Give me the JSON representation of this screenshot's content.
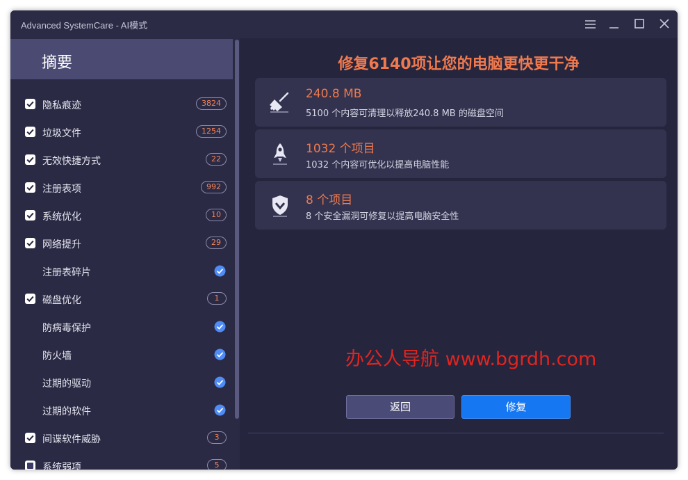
{
  "window": {
    "title": "Advanced SystemCare - AI模式"
  },
  "sidebar": {
    "title": "摘要",
    "items": [
      {
        "label": "隐私痕迹",
        "checkbox": "checked",
        "badge": "3824"
      },
      {
        "label": "垃圾文件",
        "checkbox": "checked",
        "badge": "1254"
      },
      {
        "label": "无效快捷方式",
        "checkbox": "checked",
        "badge": "22"
      },
      {
        "label": "注册表项",
        "checkbox": "checked",
        "badge": "992"
      },
      {
        "label": "系统优化",
        "checkbox": "checked",
        "badge": "10"
      },
      {
        "label": "网络提升",
        "checkbox": "checked",
        "badge": "29"
      },
      {
        "label": "注册表碎片",
        "checkbox": "none",
        "status": "ok"
      },
      {
        "label": "磁盘优化",
        "checkbox": "checked",
        "badge": "1"
      },
      {
        "label": "防病毒保护",
        "checkbox": "none",
        "status": "ok"
      },
      {
        "label": "防火墙",
        "checkbox": "none",
        "status": "ok"
      },
      {
        "label": "过期的驱动",
        "checkbox": "none",
        "status": "ok"
      },
      {
        "label": "过期的软件",
        "checkbox": "none",
        "status": "ok"
      },
      {
        "label": "间谍软件威胁",
        "checkbox": "checked",
        "badge": "3"
      },
      {
        "label": "系统弱项",
        "checkbox": "partial",
        "badge": "5"
      }
    ]
  },
  "main": {
    "headline": "修复6140项让您的电脑更快更干净",
    "cards": [
      {
        "icon": "broom-icon",
        "title": "240.8 MB",
        "desc": "5100 个内容可清理以释放240.8 MB 的磁盘空间"
      },
      {
        "icon": "rocket-icon",
        "title": "1032 个项目",
        "desc": "1032 个内容可优化以提高电脑性能"
      },
      {
        "icon": "shield-icon",
        "title": "8 个项目",
        "desc": "8 个安全漏洞可修复以提高电脑安全性"
      }
    ],
    "watermark": "办公人导航  www.bgrdh.com",
    "back_label": "返回",
    "fix_label": "修复"
  },
  "colors": {
    "accent_orange": "#f07a4e",
    "primary_button": "#1677f2",
    "ok_blue": "#4f8cf5",
    "watermark_red": "#e0251f"
  }
}
